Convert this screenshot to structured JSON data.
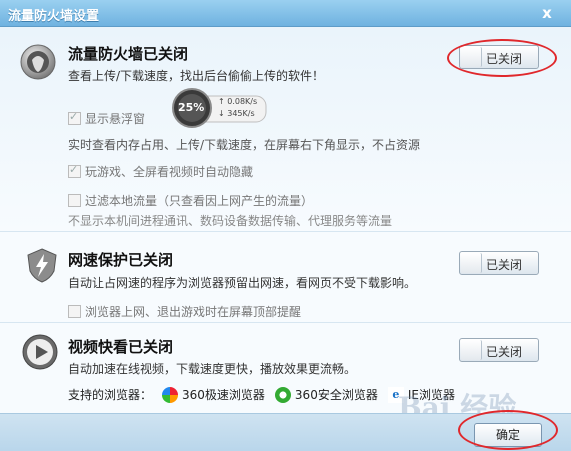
{
  "window": {
    "title": "流量防火墙设置",
    "close_label": "x"
  },
  "firewall": {
    "heading": "流量防火墙已关闭",
    "description": "查看上传/下载速度，找出后台偷偷上传的软件！",
    "toggle_label": "已关闭",
    "float_window": {
      "label": "显示悬浮窗",
      "checked": true,
      "gauge_percent": "25%",
      "upload_speed": "↑ 0.08K/s",
      "download_speed": "↓ 345K/s",
      "help": "实时查看内存占用、上传/下载速度，在屏幕右下角显示，不占资源"
    },
    "auto_hide": {
      "label": "玩游戏、全屏看视频时自动隐藏",
      "checked": true
    },
    "filter_local": {
      "label": "过滤本地流量（只查看因上网产生的流量）",
      "checked": false,
      "help": "不显示本机间进程通讯、数码设备数据传输、代理服务等流量"
    }
  },
  "speed_protect": {
    "heading": "网速保护已关闭",
    "description": "自动让占网速的程序为浏览器预留出网速，看网页不受下载影响。",
    "toggle_label": "已关闭",
    "option": {
      "label": "浏览器上网、退出游戏时在屏幕顶部提醒",
      "checked": false
    }
  },
  "video_fast": {
    "heading": "视频快看已关闭",
    "description": "自动加速在线视频，下载速度更快，播放效果更流畅。",
    "toggle_label": "已关闭",
    "supported_label": "支持的浏览器：",
    "browsers": [
      "360极速浏览器",
      "360安全浏览器",
      "IE浏览器"
    ]
  },
  "footer": {
    "ok_label": "确定"
  },
  "watermark": "Bai 经验",
  "colors": {
    "titlebar": "#6fb2e0",
    "highlight": "#e0282c",
    "accent": "#2a6fb0"
  },
  "icons": {
    "firewall": "firewall-shield-icon",
    "speed_protect": "lightning-shield-icon",
    "video_fast": "play-circle-icon",
    "browser_360_speed": "360-speed-browser-icon",
    "browser_360_safe": "360-safe-browser-icon",
    "browser_ie": "ie-browser-icon"
  }
}
